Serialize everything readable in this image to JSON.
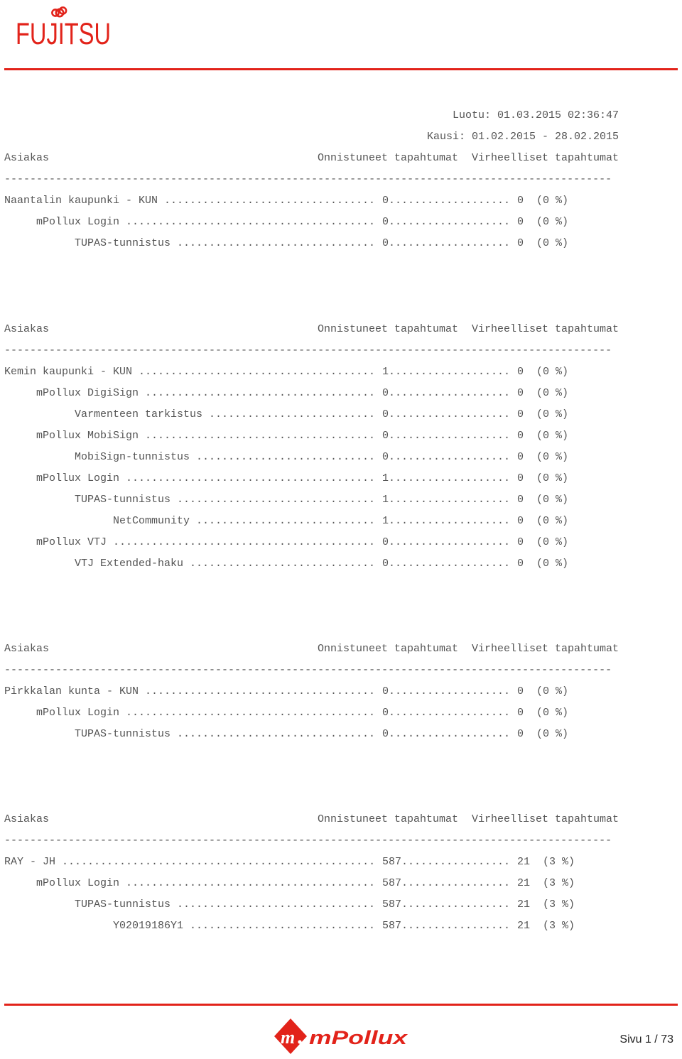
{
  "header": {
    "brand_logo": "FUJITSU",
    "brand_logo_icon": "fujitsu-infinity-icon",
    "created_label": "Luotu: 01.03.2015 02:36:47",
    "period_label": "Kausi: 01.02.2015 - 28.02.2015"
  },
  "columns": {
    "customer": "Asiakas",
    "success": "Onnistuneet tapahtumat",
    "errors": "Virheelliset tapahtumat",
    "separator": "-----------------------------------------------------------------------------------------------"
  },
  "sections": [
    {
      "rows": [
        {
          "level": 0,
          "name": "Naantalin kaupunki - KUN",
          "success": "0",
          "errors": "0",
          "percent": "(0 %)"
        },
        {
          "level": 1,
          "name": "mPollux Login",
          "success": "0",
          "errors": "0",
          "percent": "(0 %)"
        },
        {
          "level": 2,
          "name": "TUPAS-tunnistus",
          "success": "0",
          "errors": "0",
          "percent": "(0 %)"
        }
      ]
    },
    {
      "rows": [
        {
          "level": 0,
          "name": "Kemin kaupunki - KUN",
          "success": "1",
          "errors": "0",
          "percent": "(0 %)"
        },
        {
          "level": 1,
          "name": "mPollux DigiSign",
          "success": "0",
          "errors": "0",
          "percent": "(0 %)"
        },
        {
          "level": 2,
          "name": "Varmenteen tarkistus",
          "success": "0",
          "errors": "0",
          "percent": "(0 %)"
        },
        {
          "level": 1,
          "name": "mPollux MobiSign",
          "success": "0",
          "errors": "0",
          "percent": "(0 %)"
        },
        {
          "level": 2,
          "name": "MobiSign-tunnistus",
          "success": "0",
          "errors": "0",
          "percent": "(0 %)"
        },
        {
          "level": 1,
          "name": "mPollux Login",
          "success": "1",
          "errors": "0",
          "percent": "(0 %)"
        },
        {
          "level": 2,
          "name": "TUPAS-tunnistus",
          "success": "1",
          "errors": "0",
          "percent": "(0 %)"
        },
        {
          "level": 3,
          "name": "NetCommunity",
          "success": "1",
          "errors": "0",
          "percent": "(0 %)"
        },
        {
          "level": 1,
          "name": "mPollux VTJ",
          "success": "0",
          "errors": "0",
          "percent": "(0 %)"
        },
        {
          "level": 2,
          "name": "VTJ Extended-haku",
          "success": "0",
          "errors": "0",
          "percent": "(0 %)"
        }
      ]
    },
    {
      "rows": [
        {
          "level": 0,
          "name": "Pirkkalan kunta - KUN",
          "success": "0",
          "errors": "0",
          "percent": "(0 %)"
        },
        {
          "level": 1,
          "name": "mPollux Login",
          "success": "0",
          "errors": "0",
          "percent": "(0 %)"
        },
        {
          "level": 2,
          "name": "TUPAS-tunnistus",
          "success": "0",
          "errors": "0",
          "percent": "(0 %)"
        }
      ]
    },
    {
      "rows": [
        {
          "level": 0,
          "name": "RAY - JH",
          "success": "587",
          "errors": "21",
          "percent": "(3 %)"
        },
        {
          "level": 1,
          "name": "mPollux Login",
          "success": "587",
          "errors": "21",
          "percent": "(3 %)"
        },
        {
          "level": 2,
          "name": "TUPAS-tunnistus",
          "success": "587",
          "errors": "21",
          "percent": "(3 %)"
        },
        {
          "level": 3,
          "name": "Y02019186Y1",
          "success": "587",
          "errors": "21",
          "percent": "(3 %)"
        }
      ]
    }
  ],
  "footer": {
    "product_logo": "mPollux",
    "product_logo_icon": "mpollux-diamond-m-icon",
    "page_label": "Sivu 1 / 73"
  },
  "colors": {
    "brand_red": "#e2231a",
    "text_gray": "#555555"
  }
}
